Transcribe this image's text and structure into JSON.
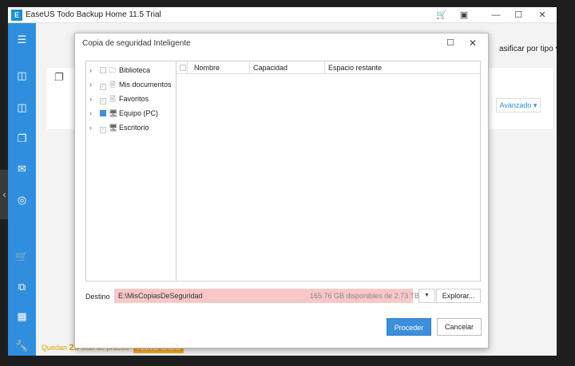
{
  "window": {
    "app_logo": "E",
    "title": "EaseUS Todo Backup Home 11.5 Trial",
    "controls": {
      "cart_icon": "cart-icon",
      "restore_alt_icon": "restore-icon",
      "minimize_glyph": "—",
      "maximize_glyph": "☐",
      "close_glyph": "✕"
    }
  },
  "sidebar": {
    "accent": "#2f8fde",
    "icons": [
      "menu-icon",
      "disk-backup-icon",
      "system-backup-icon",
      "file-backup-icon",
      "mail-backup-icon",
      "smart-backup-icon",
      "cart-icon",
      "clone-icon",
      "tools-grid-icon",
      "wrench-icon"
    ]
  },
  "content": {
    "sort_label": "asificar por tipo ▾",
    "advanced_label": "Avanzado ▾",
    "trial": {
      "prefix": "Quedan",
      "days": "28",
      "suffix": "días de prueba",
      "activate_label": "Activar ahora"
    }
  },
  "dialog": {
    "title": "Copia de seguridad Inteligente",
    "tree": [
      {
        "label": "Biblioteca",
        "icon": "folder-icon",
        "checked": "none"
      },
      {
        "label": "Mis documentos",
        "icon": "document-icon",
        "checked": "none"
      },
      {
        "label": "Favoritos",
        "icon": "star-doc-icon",
        "checked": "none"
      },
      {
        "label": "Equipo (PC)",
        "icon": "computer-icon",
        "checked": "partial"
      },
      {
        "label": "Escritorio",
        "icon": "desktop-icon",
        "checked": "none"
      }
    ],
    "columns": {
      "name": "Nombre",
      "capacity": "Capacidad",
      "free_space": "Espacio restante"
    },
    "destination": {
      "label": "Destino",
      "path": "E:\\MisCopiasDeSeguridad",
      "space": "165.76 GB disponibles de 2.73 TB",
      "browse_label": "Explorar..."
    },
    "buttons": {
      "proceed": "Proceder",
      "cancel": "Cancelar"
    }
  }
}
